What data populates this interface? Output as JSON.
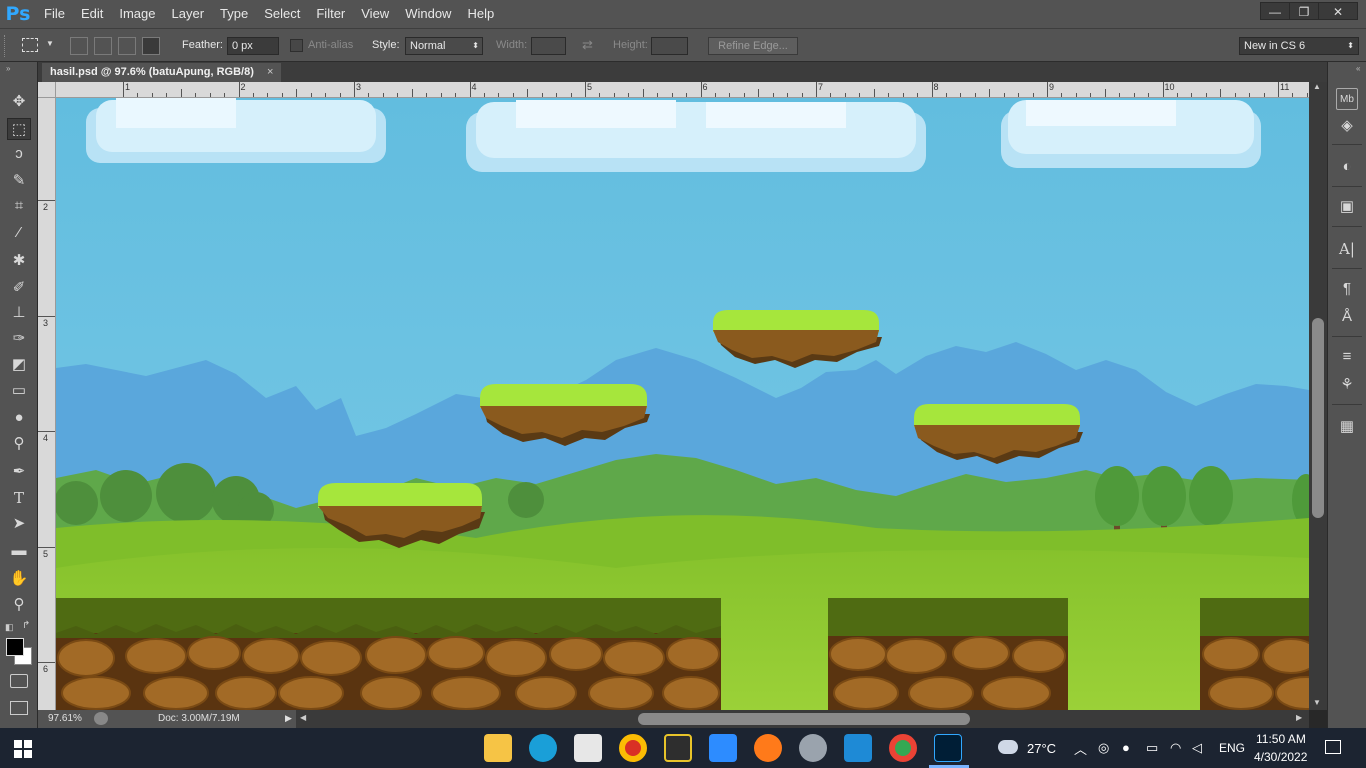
{
  "app": {
    "logo": "Ps",
    "menu": [
      "File",
      "Edit",
      "Image",
      "Layer",
      "Type",
      "Select",
      "Filter",
      "View",
      "Window",
      "Help"
    ],
    "window_controls": [
      "—",
      "❐",
      "✕"
    ]
  },
  "options": {
    "feather_label": "Feather:",
    "feather_value": "0 px",
    "antialias_label": "Anti-alias",
    "style_label": "Style:",
    "style_value": "Normal",
    "width_label": "Width:",
    "height_label": "Height:",
    "refine_edge": "Refine Edge...",
    "workspace": "New in CS 6"
  },
  "document": {
    "tab_title": "hasil.psd @ 97.6% (batuApung, RGB/8)",
    "close": "×"
  },
  "ruler": {
    "top": [
      "1",
      "2",
      "3",
      "4",
      "5",
      "6",
      "7",
      "8",
      "9",
      "10",
      "11"
    ],
    "left": [
      "2",
      "3",
      "4",
      "5",
      "6"
    ]
  },
  "status": {
    "zoom": "97.61%",
    "doc": "Doc: 3.00M/7.19M"
  },
  "taskbar": {
    "weather": "27°C",
    "language": "ENG",
    "time": "11:50 AM",
    "date": "4/30/2022"
  },
  "colors": {
    "panel": "#535353",
    "sky": "#6ec3e2",
    "grass": "#a6e63c",
    "dirt": "#8a5a1e",
    "taskbar": "#1c2431"
  },
  "tools": [
    "move-icon",
    "marquee-icon",
    "lasso-icon",
    "quick-select-icon",
    "crop-icon",
    "eyedropper-icon",
    "healing-icon",
    "brush-icon",
    "stamp-icon",
    "history-brush-icon",
    "eraser-icon",
    "gradient-icon",
    "blur-icon",
    "dodge-icon",
    "pen-icon",
    "type-icon",
    "path-select-icon",
    "shape-icon",
    "hand-icon",
    "zoom-icon"
  ]
}
